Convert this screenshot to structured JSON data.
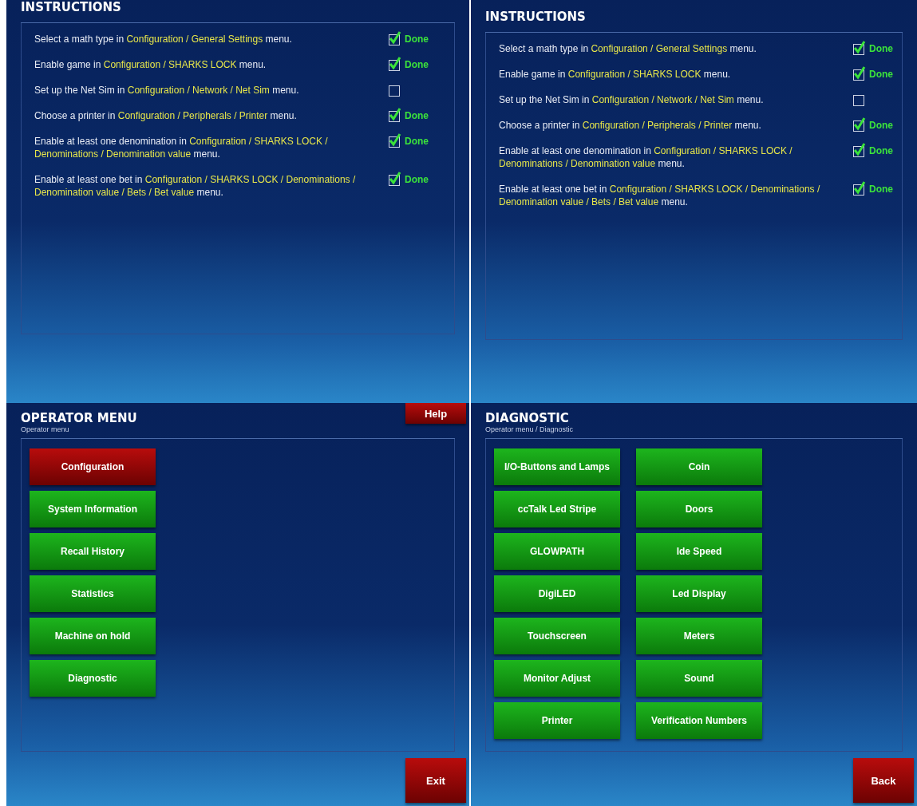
{
  "screens": [
    {
      "kind": "instructions",
      "title": "INSTRUCTIONS",
      "items": [
        {
          "parts": [
            {
              "text": "Select a math type in ",
              "highlighted": false
            },
            {
              "text": "Configuration / General Settings",
              "highlighted": true
            },
            {
              "text": " menu.",
              "highlighted": false
            }
          ],
          "checked": true,
          "status": "Done"
        },
        {
          "parts": [
            {
              "text": "Enable game in ",
              "highlighted": false
            },
            {
              "text": "Configuration / SHARKS LOCK",
              "highlighted": true
            },
            {
              "text": " menu.",
              "highlighted": false
            }
          ],
          "checked": true,
          "status": "Done"
        },
        {
          "parts": [
            {
              "text": "Set up the Net Sim in ",
              "highlighted": false
            },
            {
              "text": "Configuration / Network / Net Sim",
              "highlighted": true
            },
            {
              "text": " menu.",
              "highlighted": false
            }
          ],
          "checked": false
        },
        {
          "parts": [
            {
              "text": "Choose a printer in ",
              "highlighted": false
            },
            {
              "text": "Configuration / Peripherals / Printer",
              "highlighted": true
            },
            {
              "text": " menu.",
              "highlighted": false
            }
          ],
          "checked": true,
          "status": "Done"
        },
        {
          "parts": [
            {
              "text": "Enable at least one denomination in ",
              "highlighted": false
            },
            {
              "text": "Configuration / SHARKS LOCK / Denominations / Denomination value",
              "highlighted": true
            },
            {
              "text": " menu.",
              "highlighted": false
            }
          ],
          "checked": true,
          "status": "Done"
        },
        {
          "parts": [
            {
              "text": "Enable at least one bet in ",
              "highlighted": false
            },
            {
              "text": "Configuration / SHARKS LOCK / Denominations / Denomination value / Bets / Bet value",
              "highlighted": true
            },
            {
              "text": " menu.",
              "highlighted": false
            }
          ],
          "checked": true,
          "status": "Done"
        }
      ]
    },
    {
      "kind": "instructions",
      "title": "INSTRUCTIONS",
      "items": [
        {
          "parts": [
            {
              "text": "Select a math type in ",
              "highlighted": false
            },
            {
              "text": "Configuration / General Settings",
              "highlighted": true
            },
            {
              "text": " menu.",
              "highlighted": false
            }
          ],
          "checked": true,
          "status": "Done"
        },
        {
          "parts": [
            {
              "text": "Enable game in ",
              "highlighted": false
            },
            {
              "text": "Configuration / SHARKS LOCK",
              "highlighted": true
            },
            {
              "text": " menu.",
              "highlighted": false
            }
          ],
          "checked": true,
          "status": "Done"
        },
        {
          "parts": [
            {
              "text": "Set up the Net Sim in ",
              "highlighted": false
            },
            {
              "text": "Configuration / Network / Net Sim",
              "highlighted": true
            },
            {
              "text": " menu.",
              "highlighted": false
            }
          ],
          "checked": false
        },
        {
          "parts": [
            {
              "text": "Choose a printer in ",
              "highlighted": false
            },
            {
              "text": "Configuration / Peripherals / Printer",
              "highlighted": true
            },
            {
              "text": " menu.",
              "highlighted": false
            }
          ],
          "checked": true,
          "status": "Done"
        },
        {
          "parts": [
            {
              "text": "Enable at least one denomination in ",
              "highlighted": false
            },
            {
              "text": "Configuration / SHARKS LOCK / Denominations / Denomination value",
              "highlighted": true
            },
            {
              "text": " menu.",
              "highlighted": false
            }
          ],
          "checked": true,
          "status": "Done"
        },
        {
          "parts": [
            {
              "text": "Enable at least one bet in ",
              "highlighted": false
            },
            {
              "text": "Configuration / SHARKS LOCK / Denominations / Denomination value / Bets / Bet value",
              "highlighted": true
            },
            {
              "text": " menu.",
              "highlighted": false
            }
          ],
          "checked": true,
          "status": "Done"
        }
      ]
    },
    {
      "kind": "menu",
      "title": "OPERATOR MENU",
      "breadcrumb": "Operator menu",
      "help_button": "Help",
      "buttons": [
        {
          "label": "Configuration",
          "selected": true
        },
        {
          "label": "System Information",
          "selected": false
        },
        {
          "label": "Recall History",
          "selected": false
        },
        {
          "label": "Statistics",
          "selected": false
        },
        {
          "label": "Machine on hold",
          "selected": false
        },
        {
          "label": "Diagnostic",
          "selected": false
        }
      ],
      "footer_button": "Exit"
    },
    {
      "kind": "menu",
      "title": "DIAGNOSTIC",
      "breadcrumb": "Operator menu / Diagnostic",
      "buttons": [
        {
          "label": "I/O-Buttons and Lamps",
          "selected": false
        },
        {
          "label": "Coin",
          "selected": false
        },
        {
          "label": "ccTalk Led Stripe",
          "selected": false
        },
        {
          "label": "Doors",
          "selected": false
        },
        {
          "label": "GLOWPATH",
          "selected": false
        },
        {
          "label": "Ide Speed",
          "selected": false
        },
        {
          "label": "DigiLED",
          "selected": false
        },
        {
          "label": "Led Display",
          "selected": false
        },
        {
          "label": "Touchscreen",
          "selected": false
        },
        {
          "label": "Meters",
          "selected": false
        },
        {
          "label": "Monitor Adjust",
          "selected": false
        },
        {
          "label": "Sound",
          "selected": false
        },
        {
          "label": "Printer",
          "selected": false
        },
        {
          "label": "Verification Numbers",
          "selected": false
        }
      ],
      "footer_button": "Back"
    }
  ]
}
